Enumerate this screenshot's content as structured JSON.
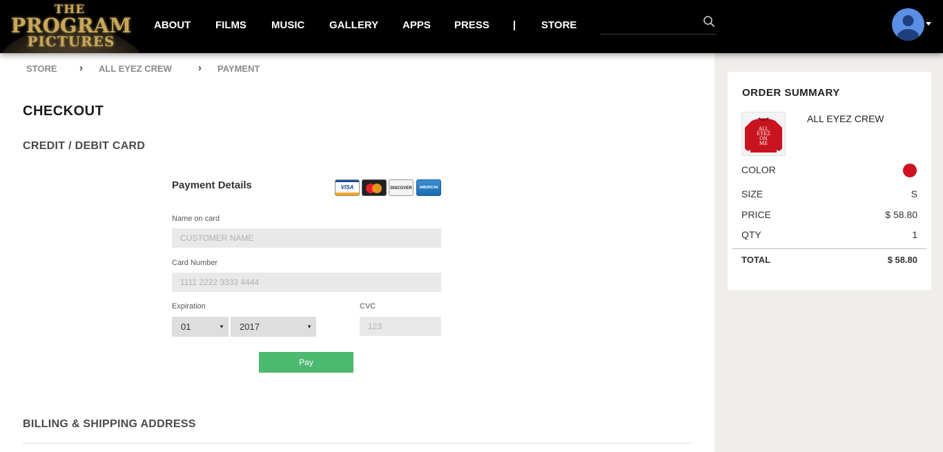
{
  "logo": {
    "line1": "THE",
    "line2": "PROGRAM",
    "line3": "PICTURES"
  },
  "nav": {
    "items": [
      "ABOUT",
      "FILMS",
      "MUSIC",
      "GALLERY",
      "APPS",
      "PRESS",
      "STORE"
    ],
    "separator": "|"
  },
  "search": {
    "placeholder": "",
    "icon": "search-icon"
  },
  "breadcrumb": {
    "items": [
      "STORE",
      "ALL EYEZ CREW",
      "PAYMENT"
    ],
    "separator": "›"
  },
  "page": {
    "title": "CHECKOUT",
    "card_section": "CREDIT / DEBIT CARD",
    "billing_section": "BILLING & SHIPPING ADDRESS"
  },
  "payment": {
    "title": "Payment Details",
    "cards": {
      "visa": "VISA",
      "mastercard": "MasterCard",
      "discover": "DISCOVER",
      "amex": "AMERICAN EXPRESS"
    },
    "name_label": "Name on card",
    "name_placeholder": "CUSTOMER NAME",
    "number_label": "Card Number",
    "number_placeholder": "1111 2222 3333 4444",
    "expiration_label": "Expiration",
    "exp_month": "01",
    "exp_year": "2017",
    "cvc_label": "CVC",
    "cvc_placeholder": "123",
    "pay_label": "Pay",
    "pay_color": "#4db870"
  },
  "order_summary": {
    "title": "ORDER SUMMARY",
    "product_name": "ALL EYEZ CREW",
    "product_image_text": "ALL EYEZ ON ME",
    "color_label": "COLOR",
    "color_value": "#d0101e",
    "size_label": "SIZE",
    "size_value": "S",
    "price_label": "PRICE",
    "price_value": "$ 58.80",
    "qty_label": "QTY",
    "qty_value": "1",
    "total_label": "TOTAL",
    "total_value": "$ 58.80"
  }
}
